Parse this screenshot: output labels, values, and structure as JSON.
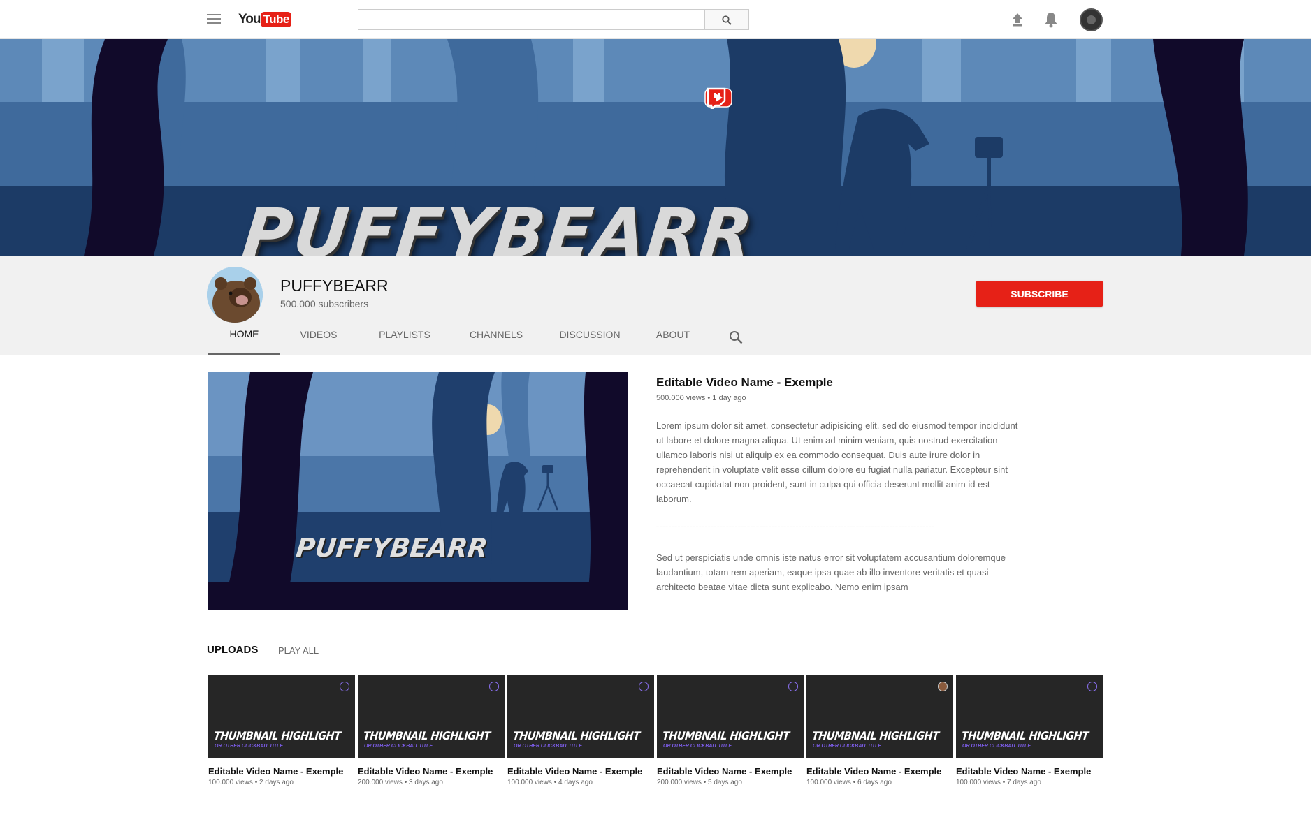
{
  "app": {
    "logo_you": "You",
    "logo_tube": "Tube",
    "search_placeholder": ""
  },
  "icons": {
    "menu": "hamburger-menu-icon",
    "search": "search-icon",
    "upload": "upload-icon",
    "notifications": "bell-icon",
    "account": "account-avatar",
    "instagram": "instagram-icon",
    "youtube": "youtube-icon",
    "twitch": "twitch-icon"
  },
  "banner": {
    "title": "PUFFYBEARR"
  },
  "channel": {
    "name": "PUFFYBEARR",
    "subscribers": "500.000 subscribers",
    "subscribe_label": "SUBSCRIBE"
  },
  "tabs": [
    {
      "label": "HOME",
      "active": true
    },
    {
      "label": "VIDEOS",
      "active": false
    },
    {
      "label": "PLAYLISTS",
      "active": false
    },
    {
      "label": "CHANNELS",
      "active": false
    },
    {
      "label": "DISCUSSION",
      "active": false
    },
    {
      "label": "ABOUT",
      "active": false
    }
  ],
  "featured": {
    "thumb_title": "PUFFYBEARR",
    "title": "Editable Video Name - Exemple",
    "meta": "500.000 views • 1 day ago",
    "description": "Lorem ipsum dolor sit amet, consectetur adipisicing elit, sed do eiusmod tempor incididunt ut labore et dolore magna aliqua. Ut enim ad minim veniam, quis nostrud exercitation ullamco laboris nisi ut aliquip ex ea commodo consequat. Duis aute irure dolor in reprehenderit in voluptate velit esse cillum dolore eu fugiat nulla pariatur. Excepteur sint occaecat cupidatat non proident, sunt in culpa qui officia deserunt mollit anim id est laborum.",
    "divider": "--------------------------------------------------------------------------------------------",
    "description2": "Sed ut perspiciatis unde omnis iste natus error sit voluptatem accusantium doloremque laudantium, totam rem aperiam, eaque ipsa quae ab illo inventore veritatis et quasi architecto beatae vitae dicta sunt explicabo. Nemo enim ipsam"
  },
  "uploads": {
    "label": "UPLOADS",
    "play_all": "PLAY ALL",
    "videos": [
      {
        "highlight": "THUMBNAIL HIGHLIGHT",
        "subtitle": "OR OTHER CLICKBAIT TITLE",
        "title": "Editable Video Name - Exemple",
        "meta": "100.000 views • 2 days ago",
        "badge": "channel-logo"
      },
      {
        "highlight": "THUMBNAIL HIGHLIGHT",
        "subtitle": "OR OTHER CLICKBAIT TITLE",
        "title": "Editable Video Name - Exemple",
        "meta": "200.000 views • 3 days ago",
        "badge": "channel-logo"
      },
      {
        "highlight": "THUMBNAIL HIGHLIGHT",
        "subtitle": "OR OTHER CLICKBAIT TITLE",
        "title": "Editable Video Name - Exemple",
        "meta": "100.000 views • 4 days ago",
        "badge": "channel-logo"
      },
      {
        "highlight": "THUMBNAIL HIGHLIGHT",
        "subtitle": "OR OTHER CLICKBAIT TITLE",
        "title": "Editable Video Name - Exemple",
        "meta": "200.000 views • 5 days ago",
        "badge": "channel-logo"
      },
      {
        "highlight": "THUMBNAIL HIGHLIGHT",
        "subtitle": "OR OTHER CLICKBAIT TITLE",
        "title": "Editable Video Name - Exemple",
        "meta": "100.000 views • 6 days ago",
        "badge": "avatar"
      },
      {
        "highlight": "THUMBNAIL HIGHLIGHT",
        "subtitle": "OR OTHER CLICKBAIT TITLE",
        "title": "Editable Video Name - Exemple",
        "meta": "100.000 views • 7 days ago",
        "badge": "channel-logo"
      }
    ]
  },
  "colors": {
    "brand_red": "#e62117",
    "banner_blue": "#2f5a8a",
    "accent_purple": "#7b5ce6"
  }
}
